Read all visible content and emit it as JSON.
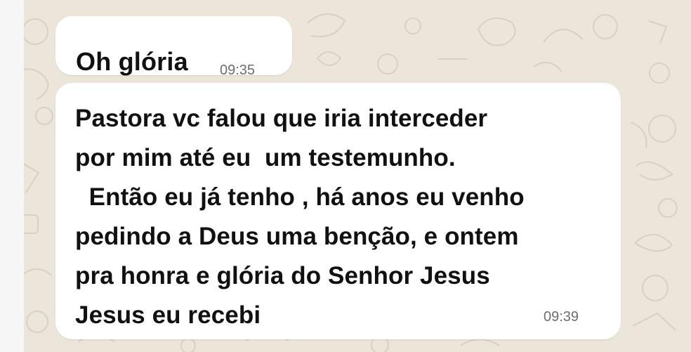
{
  "chat": {
    "theme": {
      "background": "#ece5da",
      "bubble": "#ffffff",
      "text": "#111111",
      "timestamp": "#6d6d6d"
    },
    "messages": [
      {
        "text": "Oh glória",
        "time": "09:35"
      },
      {
        "text": "Pastora vc falou que iria interceder\npor mim até eu  um testemunho.\n  Então eu já tenho , há anos eu venho\npedindo a Deus uma benção, e ontem\npra honra e glória do Senhor Jesus\nJesus eu recebi",
        "time": "09:39"
      }
    ]
  }
}
